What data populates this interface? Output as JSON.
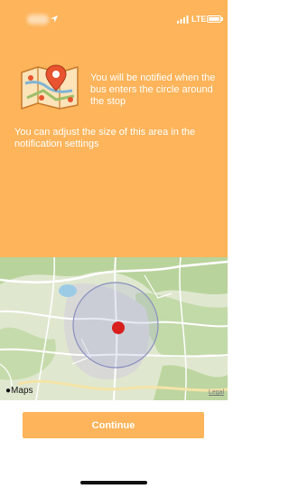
{
  "status_bar": {
    "network": "LTE",
    "icons": [
      "location-arrow-icon",
      "signal-bars-icon",
      "battery-icon"
    ]
  },
  "info": {
    "notify_text": "You will be notified when the bus enters the circle around the stop",
    "adjust_text": "You can adjust the size of this area in the notification settings",
    "illustration_icon": "map-pin-illustration-icon"
  },
  "map": {
    "attribution": "Maps",
    "attribution_icon": "apple-logo-icon",
    "legal_label": "Legal"
  },
  "actions": {
    "continue_label": "Continue"
  },
  "colors": {
    "accent": "#FDB45A",
    "stop_marker": "#D91E1E",
    "radius_circle": "#8a8fc0"
  }
}
